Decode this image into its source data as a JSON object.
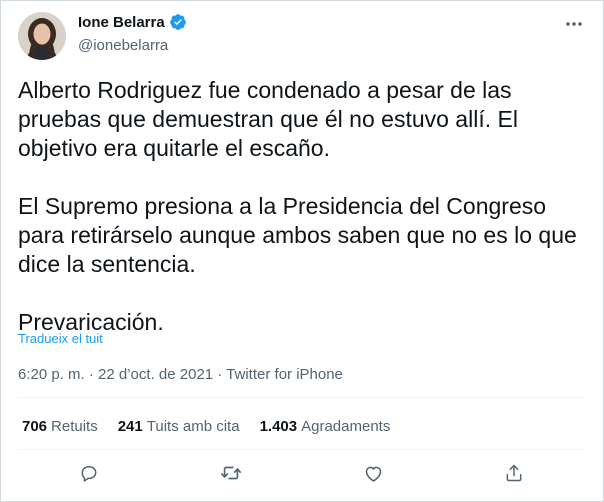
{
  "author": {
    "display_name": "Ione Belarra",
    "handle": "@ionebelarra",
    "avatar_icon": "avatar-photo",
    "verified_icon": "verified-badge-icon"
  },
  "tweet": {
    "paragraphs": [
      "Alberto Rodriguez fue condenado a pesar de las pruebas que demuestran que él no estuvo allí. El objetivo era quitarle el escaño.",
      "El Supremo presiona a la Presidencia del Congreso para retirárselo aunque ambos saben que no es lo que dice la sentencia.",
      "Prevaricación."
    ],
    "translate_label": "Tradueix el tuit",
    "meta": "6:20 p. m. · 22 d’oct. de 2021 · Twitter for iPhone"
  },
  "stats": [
    {
      "count": "706",
      "label": "Retuits"
    },
    {
      "count": "241",
      "label": "Tuits amb cita"
    },
    {
      "count": "1.403",
      "label": "Agradaments"
    }
  ],
  "actions": [
    "reply-icon",
    "retweet-icon",
    "like-icon",
    "share-icon"
  ],
  "colors": {
    "accent": "#1d9bf0",
    "secondary_text": "#536471",
    "divider": "#eff3f4"
  }
}
